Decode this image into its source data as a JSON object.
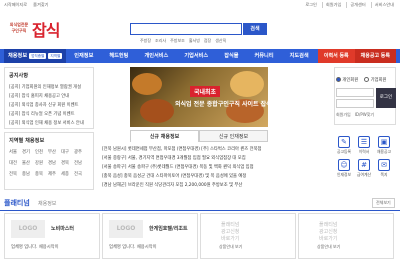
{
  "topbar": {
    "left": [
      "시작페이지로",
      "즐겨찾기"
    ],
    "right": [
      "로그인",
      "회원가입",
      "공개센터",
      "서비스안내"
    ]
  },
  "logo": {
    "small": "외식업전문\n구인구직",
    "big": "잡식"
  },
  "search": {
    "placeholder": "",
    "button": "검색",
    "keywords": [
      "주방장",
      "조리사",
      "주방보조",
      "홀서빙",
      "점장",
      "생산직"
    ]
  },
  "nav": {
    "first": "채용정보",
    "pills": [
      "업직종별",
      "지역별"
    ],
    "items": [
      "인재정보",
      "헤드헌팅",
      "개인서비스",
      "기업서비스",
      "잡식몰",
      "커뮤니티",
      "지도검색"
    ],
    "right": [
      "이력서 등록",
      "채용공고 등록"
    ]
  },
  "notice": {
    "title": "공지사항",
    "items": [
      "[공지] 기업회원의 인재정보 열람권 개설",
      "[공지] 잡식 홈피지 채용공고 안내",
      "[공지] 외식업 종사자 신규 회원 이벤트",
      "[공지] 잡식 리뉴얼 오픈 기념 이벤트",
      "[공지] 외식업 인재 채용 정보 서비스 안내"
    ]
  },
  "region": {
    "title": "지역별 채용정보",
    "cities": [
      "서울",
      "경기",
      "인천",
      "부산",
      "대구",
      "광주",
      "대전",
      "울산",
      "강원",
      "경남",
      "경북",
      "전남",
      "전북",
      "충남",
      "충북",
      "제주",
      "세종",
      "전국"
    ]
  },
  "banner": {
    "tag": "국내최초",
    "text": "외식업 전문 종합구인구직 사이트 잡식"
  },
  "tabs": [
    "신규 채용정보",
    "신규 인재정보"
  ],
  "listings": [
    "[전북 남원시] 롯데면세점 부산점, 마포점 (면접우대경) [주] 스타벅스 코리아 퀸즈 전북점",
    "[서울 중랑구] 서울, 경기지역 면접우대경 3개월점 입점 필요 외식업점장 대 모집",
    "[서울 송파구] 서울 송파구 (주)롯데월드 (면접우대경) 목동 및 백화 퀀덕 외식업 입점",
    "[충북 음성] 충북 음성군 건대 스타마이토어 (면접우대경) 및 목 음성에 있을 예정",
    "[경남 남해군] 브라운인 직원 식당관리자 모집 2,200,000원 주방보조 및 부산"
  ],
  "login": {
    "radio_personal": "개인회원",
    "radio_company": "기업회원",
    "save_id": "아이디 저장",
    "button": "로그인",
    "links": [
      "회원가입",
      "ID/PW찾기"
    ]
  },
  "quickicons": [
    "공고등록",
    "이력서",
    "채용공고",
    "인재정보",
    "급여계산",
    "쪽지",
    "이력서",
    "공고관리",
    "입사지원"
  ],
  "platinum": {
    "title": "플래티넘",
    "subtitle": "채용정보",
    "more": "전체보기"
  },
  "cards": [
    {
      "logo": "LOGO",
      "name": "노비마스터",
      "desc": "업체명 입니다. 채용시작이"
    },
    {
      "logo": "LOGO",
      "name": "한게임호텔/리조트",
      "desc": "업체명 입니다. 채용시작이"
    },
    {
      "placeholder": "플래티넘\n광고신청\n바로가기",
      "select": "상품안내 보기"
    },
    {
      "placeholder": "플래티넘\n광고신청\n바로가기",
      "select": "상품안내 보기"
    }
  ],
  "colors": {
    "brand_blue": "#2f5fd8",
    "brand_red": "#d9232e"
  }
}
